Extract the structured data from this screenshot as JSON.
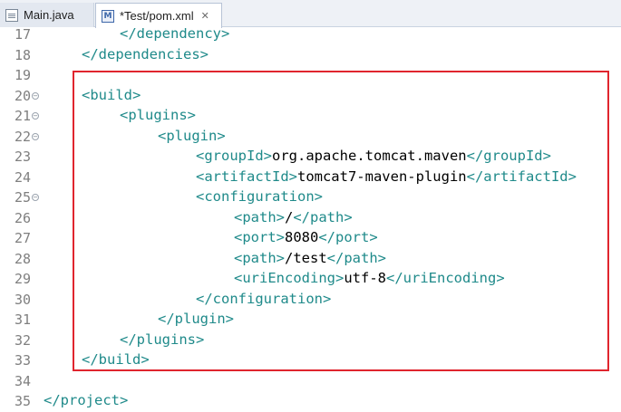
{
  "tabs": [
    {
      "label": "Main.java",
      "icon": "java-file-icon"
    },
    {
      "label": "*Test/pom.xml",
      "icon": "maven-pom-icon",
      "close_glyph": "✕"
    }
  ],
  "editor": {
    "lines": [
      {
        "num": "17",
        "indent": 2,
        "fold": false,
        "tag1": "</dependency>",
        "text": "",
        "tag2": ""
      },
      {
        "num": "18",
        "indent": 1,
        "fold": false,
        "tag1": "</dependencies>",
        "text": "",
        "tag2": ""
      },
      {
        "num": "19",
        "indent": 0,
        "fold": false,
        "tag1": "",
        "text": "",
        "tag2": ""
      },
      {
        "num": "20",
        "indent": 1,
        "fold": true,
        "tag1": "<build>",
        "text": "",
        "tag2": ""
      },
      {
        "num": "21",
        "indent": 2,
        "fold": true,
        "tag1": "<plugins>",
        "text": "",
        "tag2": ""
      },
      {
        "num": "22",
        "indent": 3,
        "fold": true,
        "tag1": "<plugin>",
        "text": "",
        "tag2": ""
      },
      {
        "num": "23",
        "indent": 4,
        "fold": false,
        "tag1": "<groupId>",
        "text": "org.apache.tomcat.maven",
        "tag2": "</groupId>"
      },
      {
        "num": "24",
        "indent": 4,
        "fold": false,
        "tag1": "<artifactId>",
        "text": "tomcat7-maven-plugin",
        "tag2": "</artifactId>"
      },
      {
        "num": "25",
        "indent": 4,
        "fold": true,
        "tag1": "<configuration>",
        "text": "",
        "tag2": ""
      },
      {
        "num": "26",
        "indent": 5,
        "fold": false,
        "tag1": "<path>",
        "text": "/",
        "tag2": "</path>"
      },
      {
        "num": "27",
        "indent": 5,
        "fold": false,
        "tag1": "<port>",
        "text": "8080",
        "tag2": "</port>"
      },
      {
        "num": "28",
        "indent": 5,
        "fold": false,
        "tag1": "<path>",
        "text": "/test",
        "tag2": "</path>"
      },
      {
        "num": "29",
        "indent": 5,
        "fold": false,
        "tag1": "<uriEncoding>",
        "text": "utf-8",
        "tag2": "</uriEncoding>"
      },
      {
        "num": "30",
        "indent": 4,
        "fold": false,
        "tag1": "</configuration>",
        "text": "",
        "tag2": ""
      },
      {
        "num": "31",
        "indent": 3,
        "fold": false,
        "tag1": "</plugin>",
        "text": "",
        "tag2": ""
      },
      {
        "num": "32",
        "indent": 2,
        "fold": false,
        "tag1": "</plugins>",
        "text": "",
        "tag2": ""
      },
      {
        "num": "33",
        "indent": 1,
        "fold": false,
        "tag1": "</build>",
        "text": "",
        "tag2": ""
      },
      {
        "num": "34",
        "indent": 0,
        "fold": false,
        "tag1": "",
        "text": "",
        "tag2": ""
      },
      {
        "num": "35",
        "indent": 0,
        "fold": false,
        "tag1": "</project>",
        "text": "",
        "tag2": ""
      }
    ]
  },
  "colors": {
    "tag": "#1f8a8a",
    "text": "#000000",
    "line_number": "#7f7f7f",
    "highlight_border": "#e0252e"
  }
}
